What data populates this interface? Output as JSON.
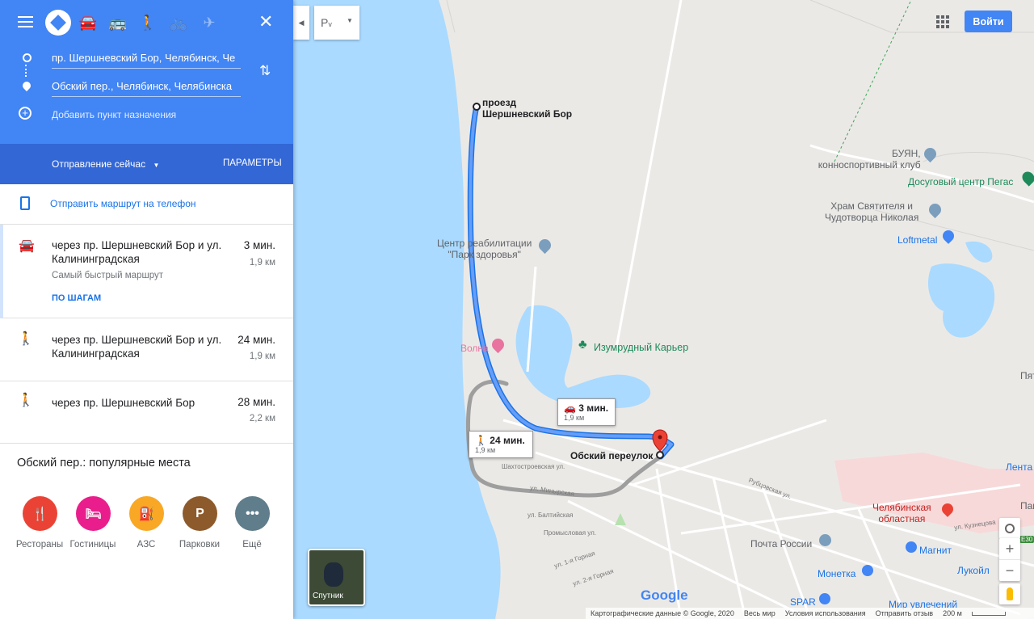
{
  "directions": {
    "origin_value": "пр. Шершневский Бор, Челябинск, Че",
    "destination_value": "Обский пер., Челябинск, Челябинска",
    "add_destination": "Добавить пункт назначения",
    "depart_now": "Отправление сейчас",
    "options": "ПАРАМЕТРЫ",
    "send_to_phone": "Отправить маршрут на телефон"
  },
  "routes": [
    {
      "mode_icon": "car-icon",
      "title": "через пр. Шершневский Бор и ул. Калининградская",
      "time": "3 мин.",
      "distance": "1,9 км",
      "note": "Самый быстрый маршрут",
      "steps_link": "ПО ШАГАМ"
    },
    {
      "mode_icon": "walk-icon",
      "title": "через пр. Шершневский Бор и ул. Калининградская",
      "time": "24 мин.",
      "distance": "1,9 км"
    },
    {
      "mode_icon": "walk-icon",
      "title": "через пр. Шершневский Бор",
      "time": "28 мин.",
      "distance": "2,2 км"
    }
  ],
  "places": {
    "heading": "Обский пер.: популярные места",
    "categories": [
      {
        "label": "Рестораны",
        "color": "#ea4335"
      },
      {
        "label": "Гостиницы",
        "color": "#e91e8c"
      },
      {
        "label": "АЗС",
        "color": "#f9a825"
      },
      {
        "label": "Парковки",
        "color": "#8d5a2b"
      },
      {
        "label": "Ещё",
        "color": "#607d8b"
      }
    ]
  },
  "map": {
    "signin": "Войти",
    "satellite": "Спутник",
    "origin_label_1": "проезд",
    "origin_label_2": "Шершневский Бор",
    "dest_label": "Обский переулок",
    "car_callout_time": "3 мин.",
    "car_callout_dist": "1,9 км",
    "walk_callout_time": "24 мин.",
    "walk_callout_dist": "1,9 км",
    "poi": {
      "buyan_1": "БУЯН,",
      "buyan_2": "конноспортивный клуб",
      "pegas": "Досуговый центр Пегас",
      "church_1": "Храм Святителя и",
      "church_2": "Чудотворца Николая",
      "loftmetal": "Loftmetal",
      "rehab_1": "Центр реабилитации",
      "rehab_2": "\"Парк здоровья\"",
      "volna": "Волна",
      "izumrud": "Изумрудный Карьер",
      "pya": "Пят",
      "lenta": "Лента",
      "hospital_1": "Челябинская",
      "hospital_2": "областная",
      "pam": "Пам",
      "post": "Почта России",
      "magnit": "Магнит",
      "moneta": "Монетка",
      "lukoil": "Лукойл",
      "spar": "SPAR",
      "mir": "Мир увлечений"
    },
    "streets": {
      "shakh": "Шахтостроевская ул.",
      "min": "ул. Минырская",
      "balt": "ул. Балтийская",
      "prom": "Промысловая ул.",
      "gor1": "ул. 1-я Горная",
      "gor2": "ул. 2-я Горная",
      "rub": "Рубцовская ул.",
      "kuz": "ул. Кузнецова",
      "e30": "E30"
    },
    "google": "Google",
    "footer": {
      "copyright": "Картографические данные © Google, 2020",
      "world": "Весь мир",
      "terms": "Условия использования",
      "feedback": "Отправить отзыв",
      "scale": "200 м"
    }
  }
}
